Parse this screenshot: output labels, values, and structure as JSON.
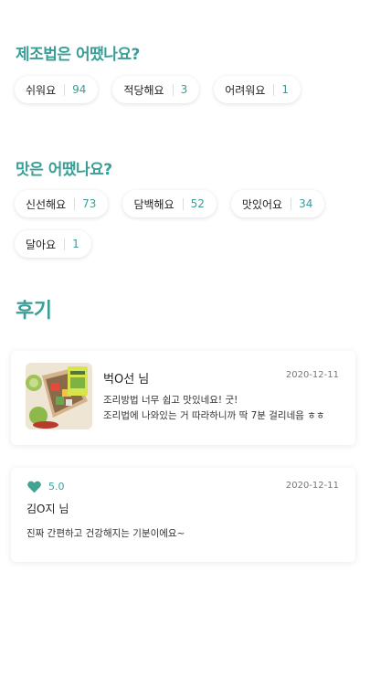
{
  "recipe_section": {
    "title": "제조법은 어땠나요?",
    "chips": [
      {
        "label": "쉬워요",
        "count": "94"
      },
      {
        "label": "적당해요",
        "count": "3"
      },
      {
        "label": "어려워요",
        "count": "1"
      }
    ]
  },
  "taste_section": {
    "title": "맛은 어땠나요?",
    "chips": [
      {
        "label": "신선해요",
        "count": "73"
      },
      {
        "label": "담백해요",
        "count": "52"
      },
      {
        "label": "맛있어요",
        "count": "34"
      },
      {
        "label": "달아요",
        "count": "1"
      }
    ]
  },
  "reviews": {
    "title": "후기",
    "items": [
      {
        "author": "벅O선 님",
        "date": "2020-12-11",
        "lines": [
          "조리방법 너무 쉽고 맛있네요! 굿!",
          "조리법에 나와있는 거 따라하니까 딱 7분 걸리네음 ㅎㅎ"
        ]
      },
      {
        "rating": "5.0",
        "author": "김O지 님",
        "date": "2020-12-11",
        "text": "진짜 간편하고 건강해지는 기분이에요~"
      }
    ]
  },
  "colors": {
    "accent": "#3a9e96",
    "heart": "#43a392"
  },
  "icons": {
    "rating": "heart-icon"
  }
}
